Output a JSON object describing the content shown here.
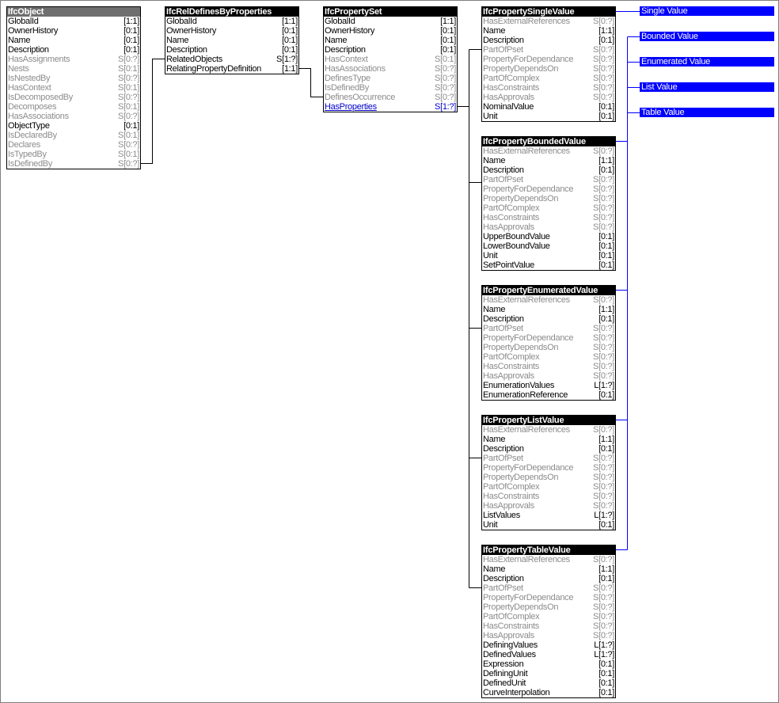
{
  "entities": [
    {
      "id": "ifcobject",
      "name": "IfcObject",
      "header_style": "dark",
      "attributes": [
        {
          "name": "GlobalId",
          "card": "[1:1]",
          "kind": "direct"
        },
        {
          "name": "OwnerHistory",
          "card": "[0:1]",
          "kind": "direct"
        },
        {
          "name": "Name",
          "card": "[0:1]",
          "kind": "direct"
        },
        {
          "name": "Description",
          "card": "[0:1]",
          "kind": "direct"
        },
        {
          "name": "HasAssignments",
          "card": "S[0:?]",
          "kind": "inverse"
        },
        {
          "name": "Nests",
          "card": "S[0:1]",
          "kind": "inverse"
        },
        {
          "name": "IsNestedBy",
          "card": "S[0:?]",
          "kind": "inverse"
        },
        {
          "name": "HasContext",
          "card": "S[0:1]",
          "kind": "inverse"
        },
        {
          "name": "IsDecomposedBy",
          "card": "S[0:?]",
          "kind": "inverse"
        },
        {
          "name": "Decomposes",
          "card": "S[0:1]",
          "kind": "inverse"
        },
        {
          "name": "HasAssociations",
          "card": "S[0:?]",
          "kind": "inverse"
        },
        {
          "name": "ObjectType",
          "card": "[0:1]",
          "kind": "direct"
        },
        {
          "name": "IsDeclaredBy",
          "card": "S[0:1]",
          "kind": "inverse"
        },
        {
          "name": "Declares",
          "card": "S[0:?]",
          "kind": "inverse"
        },
        {
          "name": "IsTypedBy",
          "card": "S[0:1]",
          "kind": "inverse"
        },
        {
          "name": "IsDefinedBy",
          "card": "S[0:?]",
          "kind": "inverse"
        }
      ]
    },
    {
      "id": "ifcreldefinesbyproperties",
      "name": "IfcRelDefinesByProperties",
      "header_style": "black",
      "attributes": [
        {
          "name": "GlobalId",
          "card": "[1:1]",
          "kind": "direct"
        },
        {
          "name": "OwnerHistory",
          "card": "[0:1]",
          "kind": "direct"
        },
        {
          "name": "Name",
          "card": "[0:1]",
          "kind": "direct"
        },
        {
          "name": "Description",
          "card": "[0:1]",
          "kind": "direct"
        },
        {
          "name": "RelatedObjects",
          "card": "S[1:?]",
          "kind": "direct"
        },
        {
          "name": "RelatingPropertyDefinition",
          "card": "[1:1]",
          "kind": "direct"
        }
      ]
    },
    {
      "id": "ifcpropertyset",
      "name": "IfcPropertySet",
      "header_style": "black",
      "attributes": [
        {
          "name": "GlobalId",
          "card": "[1:1]",
          "kind": "direct"
        },
        {
          "name": "OwnerHistory",
          "card": "[0:1]",
          "kind": "direct"
        },
        {
          "name": "Name",
          "card": "[0:1]",
          "kind": "direct"
        },
        {
          "name": "Description",
          "card": "[0:1]",
          "kind": "direct"
        },
        {
          "name": "HasContext",
          "card": "S[0:1]",
          "kind": "inverse"
        },
        {
          "name": "HasAssociations",
          "card": "S[0:?]",
          "kind": "inverse"
        },
        {
          "name": "DefinesType",
          "card": "S[0:?]",
          "kind": "inverse"
        },
        {
          "name": "IsDefinedBy",
          "card": "S[0:?]",
          "kind": "inverse"
        },
        {
          "name": "DefinesOccurrence",
          "card": "S[0:?]",
          "kind": "inverse"
        },
        {
          "name": "HasProperties",
          "card": "S[1:?]",
          "kind": "link"
        }
      ]
    },
    {
      "id": "ifcpropertysinglevalue",
      "name": "IfcPropertySingleValue",
      "header_style": "black",
      "attributes": [
        {
          "name": "HasExternalReferences",
          "card": "S[0:?]",
          "kind": "inverse"
        },
        {
          "name": "Name",
          "card": "[1:1]",
          "kind": "direct"
        },
        {
          "name": "Description",
          "card": "[0:1]",
          "kind": "direct"
        },
        {
          "name": "PartOfPset",
          "card": "S[0:?]",
          "kind": "inverse"
        },
        {
          "name": "PropertyForDependance",
          "card": "S[0:?]",
          "kind": "inverse"
        },
        {
          "name": "PropertyDependsOn",
          "card": "S[0:?]",
          "kind": "inverse"
        },
        {
          "name": "PartOfComplex",
          "card": "S[0:?]",
          "kind": "inverse"
        },
        {
          "name": "HasConstraints",
          "card": "S[0:?]",
          "kind": "inverse"
        },
        {
          "name": "HasApprovals",
          "card": "S[0:?]",
          "kind": "inverse"
        },
        {
          "name": "NominalValue",
          "card": "[0:1]",
          "kind": "direct"
        },
        {
          "name": "Unit",
          "card": "[0:1]",
          "kind": "direct"
        }
      ]
    },
    {
      "id": "ifcpropertyboundedvalue",
      "name": "IfcPropertyBoundedValue",
      "header_style": "black",
      "attributes": [
        {
          "name": "HasExternalReferences",
          "card": "S[0:?]",
          "kind": "inverse"
        },
        {
          "name": "Name",
          "card": "[1:1]",
          "kind": "direct"
        },
        {
          "name": "Description",
          "card": "[0:1]",
          "kind": "direct"
        },
        {
          "name": "PartOfPset",
          "card": "S[0:?]",
          "kind": "inverse"
        },
        {
          "name": "PropertyForDependance",
          "card": "S[0:?]",
          "kind": "inverse"
        },
        {
          "name": "PropertyDependsOn",
          "card": "S[0:?]",
          "kind": "inverse"
        },
        {
          "name": "PartOfComplex",
          "card": "S[0:?]",
          "kind": "inverse"
        },
        {
          "name": "HasConstraints",
          "card": "S[0:?]",
          "kind": "inverse"
        },
        {
          "name": "HasApprovals",
          "card": "S[0:?]",
          "kind": "inverse"
        },
        {
          "name": "UpperBoundValue",
          "card": "[0:1]",
          "kind": "direct"
        },
        {
          "name": "LowerBoundValue",
          "card": "[0:1]",
          "kind": "direct"
        },
        {
          "name": "Unit",
          "card": "[0:1]",
          "kind": "direct"
        },
        {
          "name": "SetPointValue",
          "card": "[0:1]",
          "kind": "direct"
        }
      ]
    },
    {
      "id": "ifcpropertyenumeratedvalue",
      "name": "IfcPropertyEnumeratedValue",
      "header_style": "black",
      "attributes": [
        {
          "name": "HasExternalReferences",
          "card": "S[0:?]",
          "kind": "inverse"
        },
        {
          "name": "Name",
          "card": "[1:1]",
          "kind": "direct"
        },
        {
          "name": "Description",
          "card": "[0:1]",
          "kind": "direct"
        },
        {
          "name": "PartOfPset",
          "card": "S[0:?]",
          "kind": "inverse"
        },
        {
          "name": "PropertyForDependance",
          "card": "S[0:?]",
          "kind": "inverse"
        },
        {
          "name": "PropertyDependsOn",
          "card": "S[0:?]",
          "kind": "inverse"
        },
        {
          "name": "PartOfComplex",
          "card": "S[0:?]",
          "kind": "inverse"
        },
        {
          "name": "HasConstraints",
          "card": "S[0:?]",
          "kind": "inverse"
        },
        {
          "name": "HasApprovals",
          "card": "S[0:?]",
          "kind": "inverse"
        },
        {
          "name": "EnumerationValues",
          "card": "L[1:?]",
          "kind": "direct"
        },
        {
          "name": "EnumerationReference",
          "card": "[0:1]",
          "kind": "direct"
        }
      ]
    },
    {
      "id": "ifcpropertylistvalue",
      "name": "IfcPropertyListValue",
      "header_style": "black",
      "attributes": [
        {
          "name": "HasExternalReferences",
          "card": "S[0:?]",
          "kind": "inverse"
        },
        {
          "name": "Name",
          "card": "[1:1]",
          "kind": "direct"
        },
        {
          "name": "Description",
          "card": "[0:1]",
          "kind": "direct"
        },
        {
          "name": "PartOfPset",
          "card": "S[0:?]",
          "kind": "inverse"
        },
        {
          "name": "PropertyForDependance",
          "card": "S[0:?]",
          "kind": "inverse"
        },
        {
          "name": "PropertyDependsOn",
          "card": "S[0:?]",
          "kind": "inverse"
        },
        {
          "name": "PartOfComplex",
          "card": "S[0:?]",
          "kind": "inverse"
        },
        {
          "name": "HasConstraints",
          "card": "S[0:?]",
          "kind": "inverse"
        },
        {
          "name": "HasApprovals",
          "card": "S[0:?]",
          "kind": "inverse"
        },
        {
          "name": "ListValues",
          "card": "L[1:?]",
          "kind": "direct"
        },
        {
          "name": "Unit",
          "card": "[0:1]",
          "kind": "direct"
        }
      ]
    },
    {
      "id": "ifcpropertytablevalue",
      "name": "IfcPropertyTableValue",
      "header_style": "black",
      "attributes": [
        {
          "name": "HasExternalReferences",
          "card": "S[0:?]",
          "kind": "inverse"
        },
        {
          "name": "Name",
          "card": "[1:1]",
          "kind": "direct"
        },
        {
          "name": "Description",
          "card": "[0:1]",
          "kind": "direct"
        },
        {
          "name": "PartOfPset",
          "card": "S[0:?]",
          "kind": "inverse"
        },
        {
          "name": "PropertyForDependance",
          "card": "S[0:?]",
          "kind": "inverse"
        },
        {
          "name": "PropertyDependsOn",
          "card": "S[0:?]",
          "kind": "inverse"
        },
        {
          "name": "PartOfComplex",
          "card": "S[0:?]",
          "kind": "inverse"
        },
        {
          "name": "HasConstraints",
          "card": "S[0:?]",
          "kind": "inverse"
        },
        {
          "name": "HasApprovals",
          "card": "S[0:?]",
          "kind": "inverse"
        },
        {
          "name": "DefiningValues",
          "card": "L[1:?]",
          "kind": "direct"
        },
        {
          "name": "DefinedValues",
          "card": "L[1:?]",
          "kind": "direct"
        },
        {
          "name": "Expression",
          "card": "[0:1]",
          "kind": "direct"
        },
        {
          "name": "DefiningUnit",
          "card": "[0:1]",
          "kind": "direct"
        },
        {
          "name": "DefinedUnit",
          "card": "[0:1]",
          "kind": "direct"
        },
        {
          "name": "CurveInterpolation",
          "card": "[0:1]",
          "kind": "direct"
        }
      ]
    }
  ],
  "labels": [
    {
      "id": "single",
      "text": "Single Value"
    },
    {
      "id": "bounded",
      "text": "Bounded Value"
    },
    {
      "id": "enumerated",
      "text": "Enumerated Value"
    },
    {
      "id": "list",
      "text": "List Value"
    },
    {
      "id": "table",
      "text": "Table Value"
    }
  ],
  "colors": {
    "entity_header": "#000000",
    "entity_header_dark": "#6f6f6f",
    "inverse_text": "#8c8c8c",
    "link_text": "#0000cc",
    "label_fill": "#0000ff",
    "connector_black": "#000000",
    "connector_blue": "#0000ff"
  }
}
